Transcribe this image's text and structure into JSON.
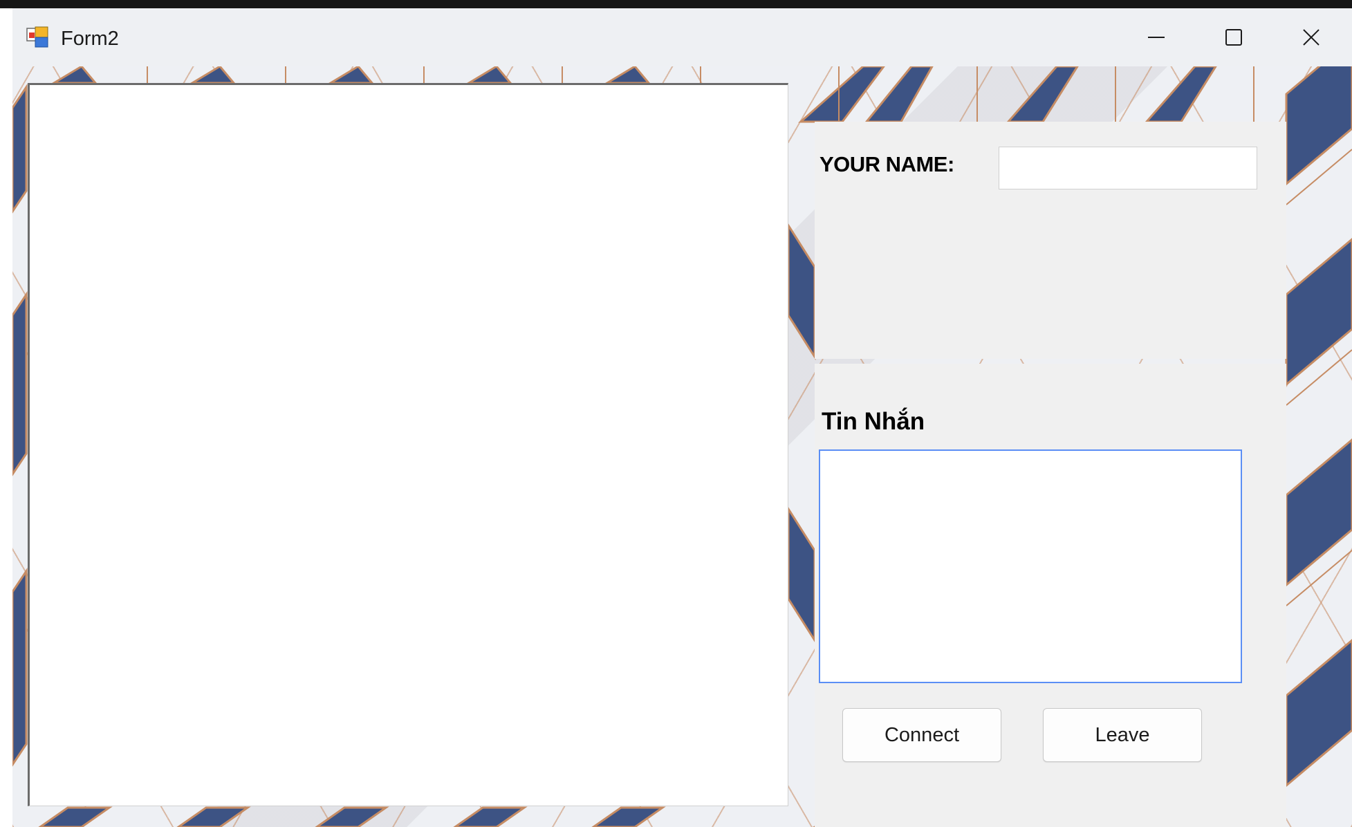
{
  "window": {
    "title": "Form2",
    "app_icon": "winforms-app-icon",
    "controls": {
      "minimize": "minimize-icon",
      "maximize": "maximize-icon",
      "close": "close-icon"
    }
  },
  "chat": {
    "messages": []
  },
  "name_panel": {
    "label": "YOUR NAME:",
    "value": "",
    "placeholder": ""
  },
  "message_panel": {
    "label": "Tin Nhắn",
    "value": "",
    "placeholder": ""
  },
  "buttons": {
    "connect": "Connect",
    "leave": "Leave"
  },
  "colors": {
    "navy": "#3d5384",
    "copper": "#c68c64",
    "panel": "#f0f0f0",
    "focus_border": "#5b8ef5"
  }
}
